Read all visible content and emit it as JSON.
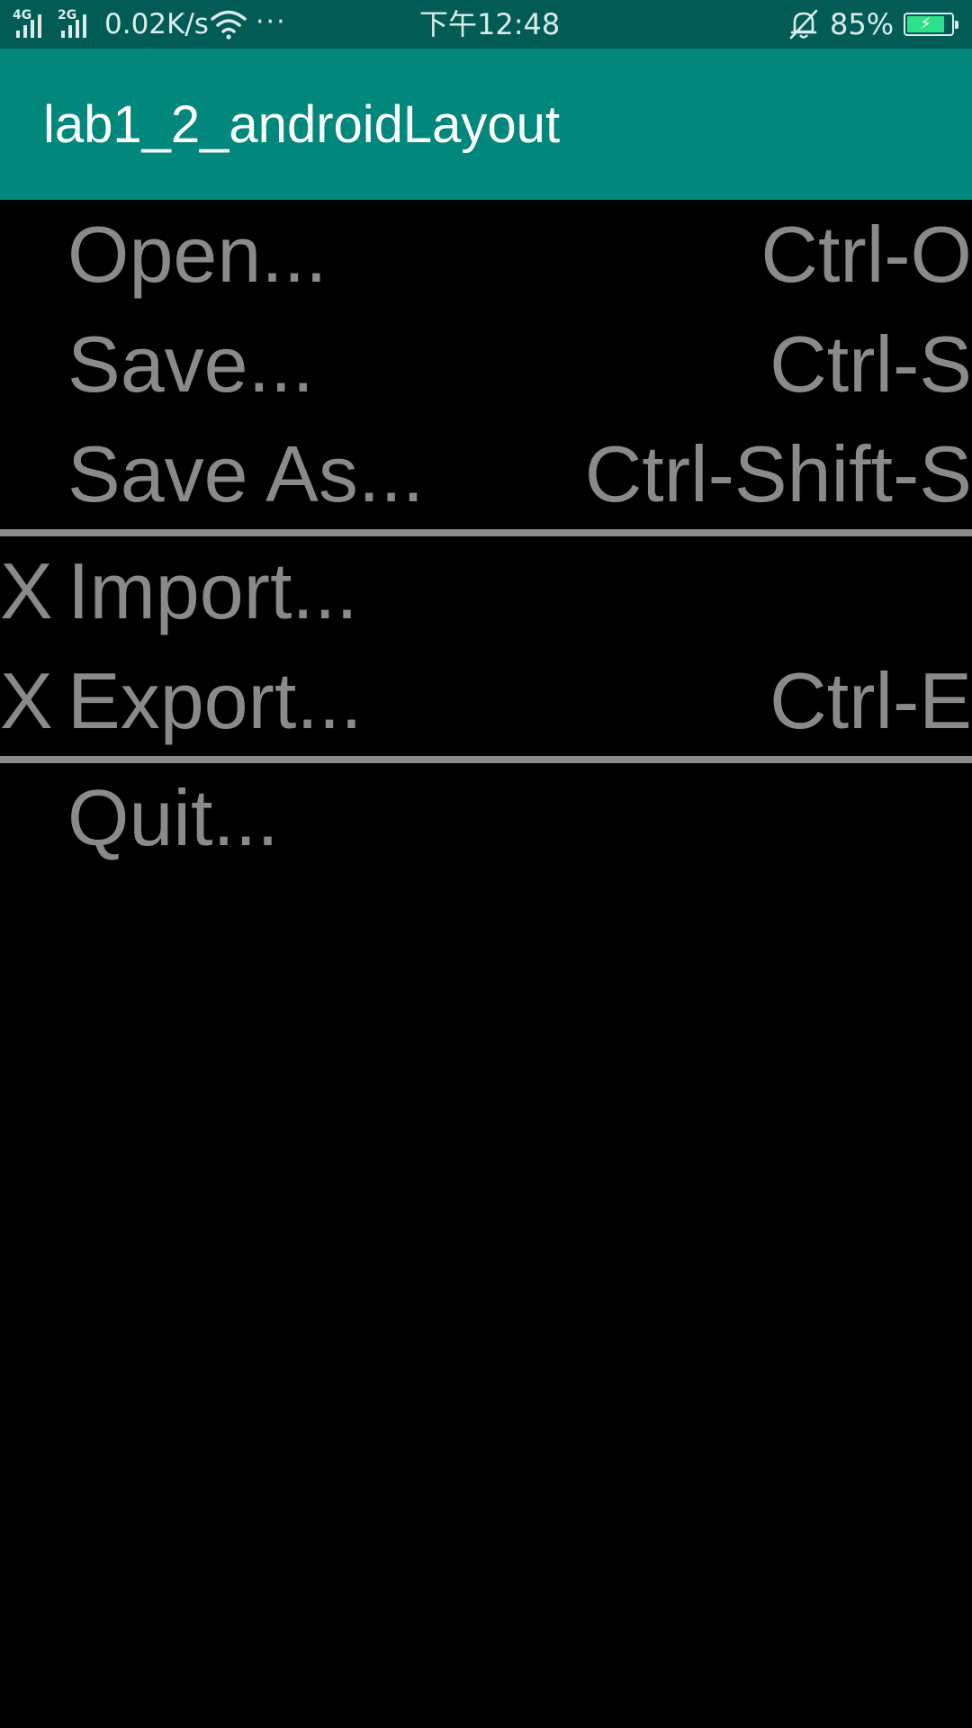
{
  "status_bar": {
    "signal1_tag": "4G",
    "signal2_tag": "2G",
    "net_speed": "0.02K/s",
    "more": "···",
    "time": "下午12:48",
    "battery_pct": "85%",
    "battery_level": 0.85,
    "icons": [
      "signal-icon",
      "signal-icon",
      "wifi-icon",
      "more-icon",
      "bell-muted-icon",
      "battery-icon"
    ]
  },
  "app_bar": {
    "title": "lab1_2_androidLayout"
  },
  "colors": {
    "status_bar_bg": "#025c55",
    "app_bar_bg": "#02877c",
    "menu_text": "#8a8a8a",
    "background": "#000000",
    "battery_fill": "#2fe08a"
  },
  "menu": {
    "group1": [
      {
        "mark": "",
        "label": "Open...",
        "shortcut": "Ctrl-O"
      },
      {
        "mark": "",
        "label": "Save...",
        "shortcut": "Ctrl-S"
      },
      {
        "mark": "",
        "label": "Save As...",
        "shortcut": "Ctrl-Shift-S"
      }
    ],
    "group2": [
      {
        "mark": "X",
        "label": "Import...",
        "shortcut": ""
      },
      {
        "mark": "X",
        "label": "Export...",
        "shortcut": "Ctrl-E"
      }
    ],
    "group3": [
      {
        "mark": "",
        "label": "Quit...",
        "shortcut": ""
      }
    ]
  }
}
